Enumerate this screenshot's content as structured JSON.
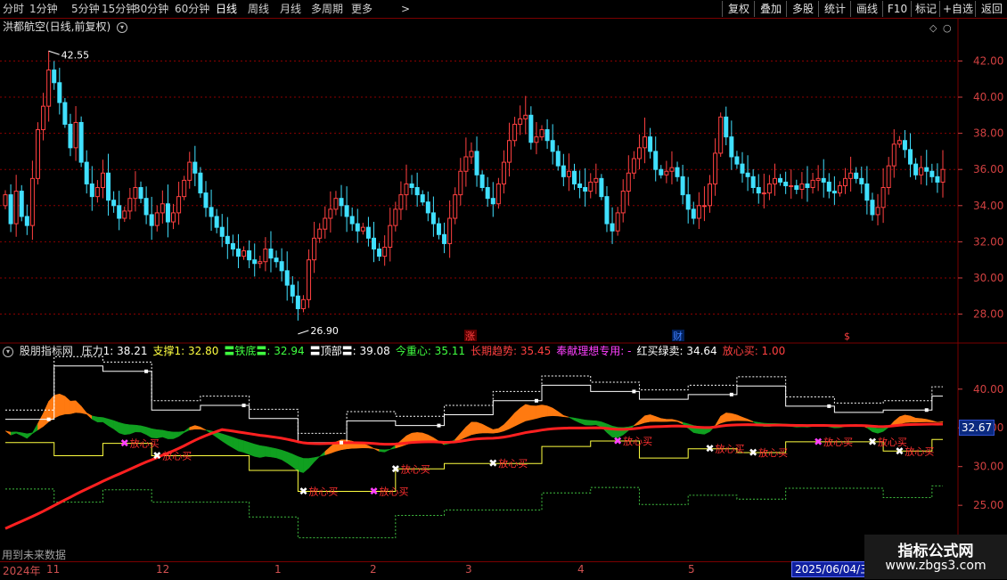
{
  "toolbar": {
    "periods": [
      "分时",
      "1分钟",
      "5分钟",
      "15分钟",
      "30分钟",
      "60分钟",
      "日线",
      "周线",
      "月线",
      "多周期",
      "更多"
    ],
    "active_period": "日线",
    "more_arrow": ">",
    "right_buttons": [
      "复权",
      "叠加",
      "多股",
      "统计",
      "画线",
      "F10",
      "标记",
      "+自选",
      "返回"
    ]
  },
  "main_panel": {
    "title": "洪都航空(日线,前复权)",
    "high_label": "42.55",
    "low_label": "26.90",
    "y_ticks": [
      "42.00",
      "40.00",
      "38.00",
      "36.00",
      "34.00",
      "32.00",
      "30.00",
      "28.00"
    ],
    "event_markers": [
      "涨",
      "财",
      "$"
    ],
    "colors": {
      "up": "#ff4040",
      "down": "#40e0ff",
      "grid": "#8b0000",
      "axis": "#d04040"
    }
  },
  "indicator_panel": {
    "name": "股朋指标网",
    "items": [
      {
        "label": "压力1: 38.21",
        "color": "#ffffff"
      },
      {
        "label": "支撑1: 32.80",
        "color": "#ffff40"
      },
      {
        "label": "〓铁底〓: 32.94",
        "color": "#40ff40"
      },
      {
        "label": "〓顶部〓: 39.08",
        "color": "#ffffff"
      },
      {
        "label": "今重心: 35.11",
        "color": "#40ff40"
      },
      {
        "label": "长期趋势: 35.45",
        "color": "#ff4040"
      },
      {
        "label": "奉献理想专用: -",
        "color": "#ff40ff"
      },
      {
        "label": "红买绿卖: 34.64",
        "color": "#ffffff"
      },
      {
        "label": "放心买: 1.00",
        "color": "#ff4040"
      }
    ],
    "y_ticks": [
      "40.00",
      "35.00",
      "30.00",
      "25.00",
      "20.00"
    ],
    "signal_label": "放心买",
    "price_tag": "32.67",
    "bottom_text": "用到未来数据"
  },
  "date_axis": {
    "labels": [
      "2024年",
      "11",
      "12",
      "1",
      "2",
      "3",
      "4",
      "5"
    ],
    "selected_date": "2025/06/04/三"
  },
  "watermark": {
    "line1": "指标公式网",
    "line2": "www.zbgs3.com"
  },
  "chart_data": {
    "type": "candlestick",
    "y_range": [
      26.5,
      43.5
    ],
    "high": 42.55,
    "low": 26.9,
    "closes": [
      34.6,
      33.0,
      34.8,
      33.4,
      32.9,
      35.5,
      38.2,
      39.5,
      41.5,
      40.8,
      39.7,
      38.5,
      37.2,
      38.6,
      36.4,
      35.2,
      34.5,
      35.0,
      35.8,
      34.3,
      34.0,
      33.3,
      33.7,
      34.4,
      35.0,
      34.4,
      33.5,
      32.9,
      33.6,
      34.1,
      33.1,
      33.6,
      34.5,
      35.4,
      36.4,
      35.8,
      34.7,
      33.9,
      33.4,
      32.8,
      32.3,
      31.9,
      31.6,
      31.2,
      31.5,
      31.0,
      30.8,
      30.9,
      31.6,
      31.1,
      30.9,
      30.4,
      29.6,
      29.0,
      28.3,
      28.8,
      31.0,
      32.2,
      32.7,
      33.3,
      33.8,
      34.4,
      34.0,
      33.4,
      33.0,
      32.6,
      32.8,
      32.2,
      31.6,
      31.2,
      31.7,
      32.9,
      33.8,
      34.6,
      35.2,
      35.0,
      34.6,
      34.2,
      33.6,
      33.0,
      32.4,
      31.9,
      33.3,
      34.6,
      35.9,
      36.7,
      37.0,
      35.7,
      35.0,
      34.4,
      34.1,
      35.2,
      36.4,
      37.6,
      38.5,
      38.8,
      39.0,
      37.5,
      37.8,
      38.2,
      37.6,
      37.0,
      36.2,
      35.6,
      35.9,
      35.2,
      35.0,
      34.8,
      35.3,
      35.5,
      34.5,
      33.0,
      32.6,
      33.6,
      34.8,
      35.8,
      36.6,
      37.2,
      37.8,
      37.0,
      36.0,
      35.7,
      35.9,
      36.1,
      35.6,
      34.6,
      33.8,
      33.3,
      34.0,
      34.0,
      35.2,
      36.9,
      38.9,
      37.8,
      36.7,
      36.3,
      35.8,
      35.6,
      35.0,
      34.7,
      34.7,
      35.2,
      35.5,
      35.3,
      35.1,
      35.1,
      34.9,
      35.2,
      35.0,
      35.4,
      35.5,
      35.3,
      34.8,
      34.7,
      35.1,
      35.5,
      35.8,
      35.5,
      35.2,
      34.3,
      33.5,
      33.9,
      35.0,
      36.2,
      37.4,
      37.6,
      37.1,
      36.3,
      35.7,
      36.1,
      35.9,
      35.6,
      35.3,
      36.0
    ],
    "support_line": 32.8,
    "pressure_line": 38.21,
    "trend_value": 35.45,
    "gravity_value": 35.11,
    "bottom_value": 32.94,
    "top_value": 39.08,
    "signal_value": 34.64,
    "buy_flag": 1.0
  }
}
